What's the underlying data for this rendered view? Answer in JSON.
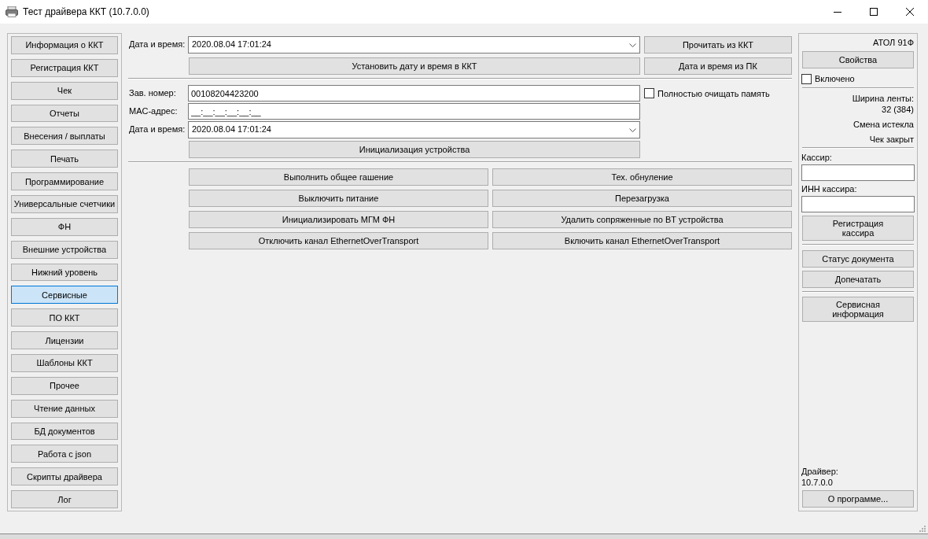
{
  "window": {
    "title": "Тест драйвера ККТ (10.7.0.0)"
  },
  "nav": [
    {
      "label": "Информация о ККТ",
      "selected": false
    },
    {
      "label": "Регистрация ККТ",
      "selected": false
    },
    {
      "label": "Чек",
      "selected": false
    },
    {
      "label": "Отчеты",
      "selected": false
    },
    {
      "label": "Внесения / выплаты",
      "selected": false
    },
    {
      "label": "Печать",
      "selected": false
    },
    {
      "label": "Программирование",
      "selected": false
    },
    {
      "label": "Универсальные счетчики",
      "selected": false
    },
    {
      "label": "ФН",
      "selected": false
    },
    {
      "label": "Внешние устройства",
      "selected": false
    },
    {
      "label": "Нижний уровень",
      "selected": false
    },
    {
      "label": "Сервисные",
      "selected": true
    },
    {
      "label": "ПО ККТ",
      "selected": false
    },
    {
      "label": "Лицензии",
      "selected": false
    },
    {
      "label": "Шаблоны ККТ",
      "selected": false
    },
    {
      "label": "Прочее",
      "selected": false
    },
    {
      "label": "Чтение данных",
      "selected": false
    },
    {
      "label": "БД документов",
      "selected": false
    },
    {
      "label": "Работа с json",
      "selected": false
    },
    {
      "label": "Скрипты драйвера",
      "selected": false
    },
    {
      "label": "Лог",
      "selected": false
    }
  ],
  "datetime": {
    "label": "Дата и время:",
    "value": "2020.08.04 17:01:24",
    "read_button": "Прочитать из ККТ",
    "set_button": "Установить дату и время в ККТ",
    "pc_button": "Дата и время из ПК"
  },
  "initialization": {
    "serial_label": "Зав. номер:",
    "serial_value": "00108204423200",
    "clear_memory": {
      "label": "Полностью очищать память",
      "checked": false
    },
    "mac_label": "MAC-адрес:",
    "mac_value": "__:__:__:__:__:__",
    "datetime_label": "Дата и время:",
    "datetime_value": "2020.08.04 17:01:24",
    "button": "Инициализация устройства"
  },
  "actions": [
    "Выполнить общее гашение",
    "Тех. обнуление",
    "Выключить питание",
    "Перезагрузка",
    "Инициализировать МГМ ФН",
    "Удалить сопряженные по BT устройства",
    "Отключить канал EthernetOverTransport",
    "Включить канал EthernetOverTransport"
  ],
  "device": {
    "model": "АТОЛ 91Ф",
    "properties_button": "Свойства",
    "enabled": {
      "label": "Включено",
      "checked": false
    },
    "tape_width_label": "Ширина ленты:",
    "tape_width_value": "32 (384)",
    "shift_status": "Смена истекла",
    "receipt_status": "Чек закрыт",
    "cashier_label": "Кассир:",
    "cashier_inn_label": "ИНН кассира:",
    "register_cashier_button": "Регистрация кассира",
    "document_status_button": "Статус документа",
    "reprint_button": "Допечатать",
    "service_info_button": "Сервисная информация",
    "driver_label": "Драйвер:",
    "driver_version": "10.7.0.0",
    "about_button": "О программе..."
  }
}
